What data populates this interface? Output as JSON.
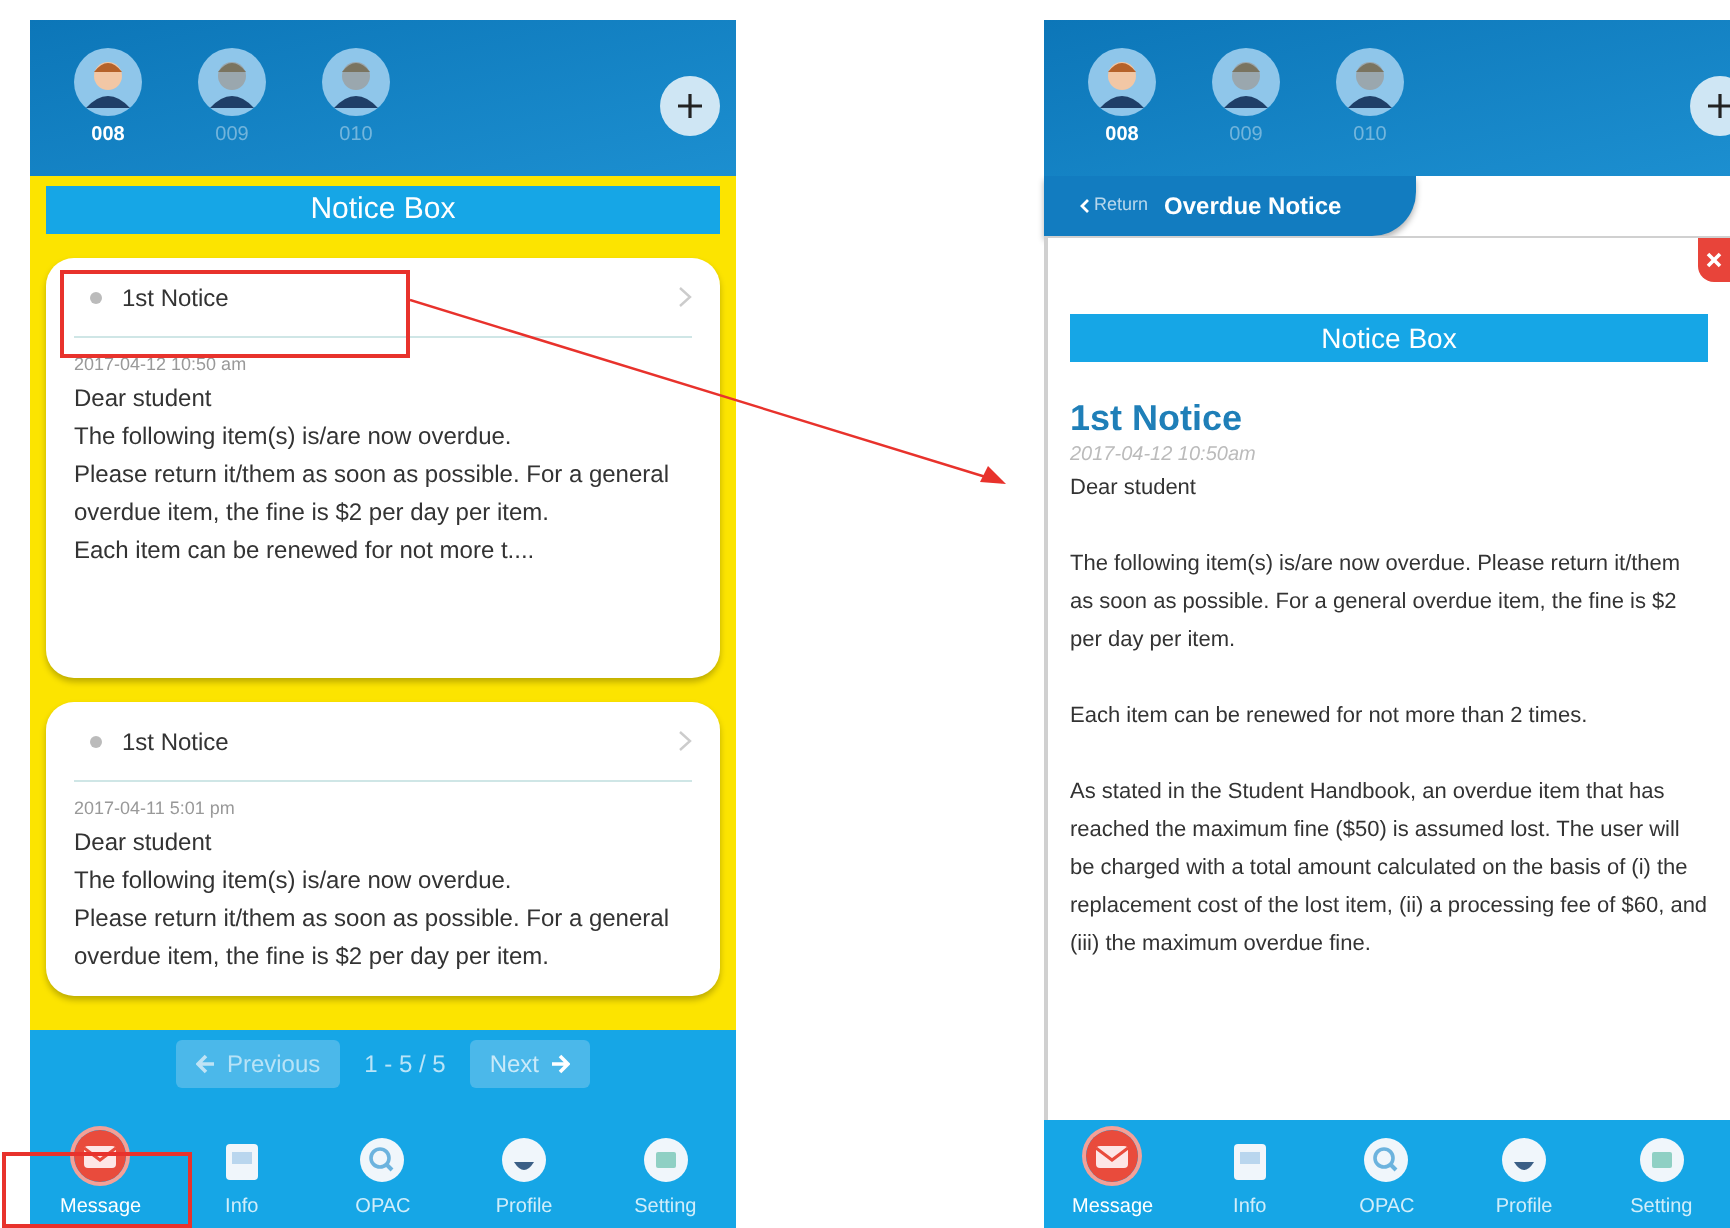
{
  "left_screen": {
    "profiles": [
      {
        "label": "008",
        "selected": true
      },
      {
        "label": "009",
        "selected": false
      },
      {
        "label": "010",
        "selected": false
      }
    ],
    "title": "Notice Box",
    "notices": [
      {
        "title": "1st Notice",
        "date": "2017-04-12 10:50 am",
        "greeting": "Dear student",
        "lines": [
          "The following item(s) is/are now overdue.",
          "Please return it/them as soon as possible. For a general overdue item, the fine is $2 per day per item.",
          "Each item can be renewed for not more t...."
        ]
      },
      {
        "title": "1st Notice",
        "date": "2017-04-11 5:01 pm",
        "greeting": "Dear student",
        "lines": [
          "The following item(s) is/are now overdue.",
          "Please return it/them as soon as possible. For a general overdue item, the fine is $2 per day per item."
        ]
      }
    ],
    "pagination": {
      "previous": "Previous",
      "page": "1 - 5 / 5",
      "next": "Next"
    },
    "tabs": [
      {
        "label": "Message",
        "kind": "message",
        "selected": true
      },
      {
        "label": "Info",
        "kind": "info",
        "selected": false
      },
      {
        "label": "OPAC",
        "kind": "opac",
        "selected": false
      },
      {
        "label": "Profile",
        "kind": "profile",
        "selected": false
      },
      {
        "label": "Setting",
        "kind": "setting",
        "selected": false
      }
    ]
  },
  "right_screen": {
    "profiles": [
      {
        "label": "008",
        "selected": true
      },
      {
        "label": "009",
        "selected": false
      },
      {
        "label": "010",
        "selected": false
      }
    ],
    "return": "Return",
    "header_title": "Overdue Notice",
    "title": "Notice Box",
    "notice": {
      "title": "1st Notice",
      "date": "2017-04-12 10:50am",
      "paragraphs": [
        "Dear student",
        "The following item(s) is/are now overdue. Please return it/them as soon as possible. For a general overdue item, the fine is $2 per day per item.",
        "Each item can be renewed for not more than 2 times.",
        "As stated in the Student Handbook, an overdue item that has reached the maximum fine ($50) is assumed lost. The user will be charged with a total amount calculated on the basis of (i) the replacement cost of the lost item, (ii) a processing fee of $60, and (iii) the maximum overdue fine."
      ]
    },
    "tabs": [
      {
        "label": "Message",
        "kind": "message",
        "selected": true
      },
      {
        "label": "Info",
        "kind": "info",
        "selected": false
      },
      {
        "label": "OPAC",
        "kind": "opac",
        "selected": false
      },
      {
        "label": "Profile",
        "kind": "profile",
        "selected": false
      },
      {
        "label": "Setting",
        "kind": "setting",
        "selected": false
      }
    ]
  }
}
